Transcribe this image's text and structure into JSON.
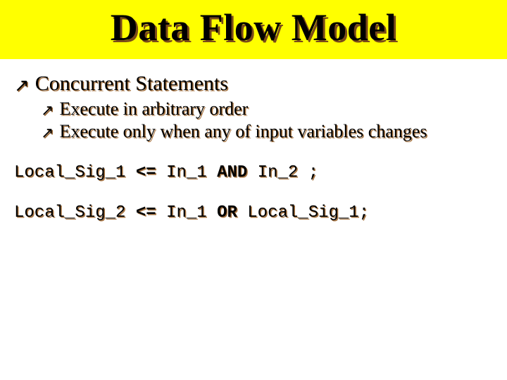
{
  "title": "Data Flow Model",
  "bullets": {
    "main": "Concurrent Statements",
    "sub1": "Execute in arbitrary order",
    "sub2": "Execute only when any of input variables changes"
  },
  "code": {
    "line1": {
      "sig": "Local_Sig_1 ",
      "op": "<=",
      "mid": " In_1 ",
      "kw": "AND",
      "tail": " In_2 ;"
    },
    "line2": {
      "sig": "Local_Sig_2 ",
      "op": "<=",
      "mid": " In_1 ",
      "kw": "OR",
      "tail": " Local_Sig_1;"
    }
  }
}
